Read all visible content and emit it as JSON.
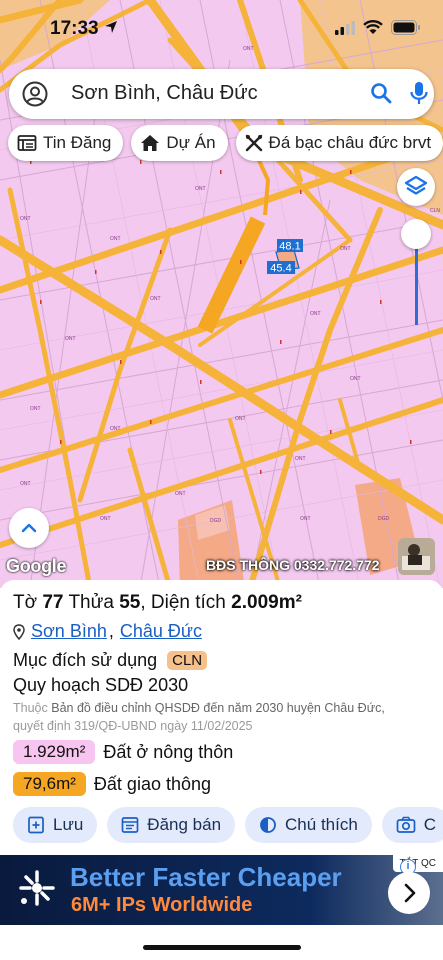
{
  "status_bar": {
    "time": "17:33"
  },
  "search": {
    "query": "Sơn Bình, Châu Đức"
  },
  "chips": [
    {
      "label": "Tin Đăng",
      "icon": "newspaper-icon"
    },
    {
      "label": "Dự Án",
      "icon": "house-icon"
    },
    {
      "label": "Đá bạc châu đức brvt",
      "icon": "crossed-tools-icon"
    }
  ],
  "map": {
    "zone_label": "ONT",
    "edge_label": "CLN",
    "parcel_labels": {
      "upper": "48.1",
      "lower": "45.4"
    },
    "pink_zone_label": "DGD",
    "attribution": "Google",
    "watermark": "BĐS THÔNG 0332.772.772"
  },
  "panel": {
    "title_prefix": "Tờ",
    "sheet_no": "77",
    "title_parcel": "Thửa",
    "parcel_no": "55",
    "area_label": ", Diện tích",
    "area_value": "2.009m²",
    "location": {
      "commune": "Sơn Bình",
      "separator": ",",
      "district": "Châu Đức"
    },
    "purpose_label": "Mục đích sử dụng",
    "purpose_code": "CLN",
    "plan_title": "Quy hoạch SDĐ 2030",
    "plan_note_prefix": "Thuộc",
    "plan_note": "Bản đồ điều chỉnh QHSDĐ đến năm 2030 huyện Châu Đức,",
    "plan_note_line2": "quyết định 319/QĐ-UBND ngày 11/02/2025",
    "legend": [
      {
        "area": "1.929m²",
        "label": "Đất ở nông thôn",
        "color": "#f8c4f0"
      },
      {
        "area": "79,6m²",
        "label": "Đất giao thông",
        "color": "#f5a623"
      }
    ],
    "actions": [
      {
        "label": "Lưu",
        "icon": "bookmark-plus-icon"
      },
      {
        "label": "Đăng bán",
        "icon": "listing-icon"
      },
      {
        "label": "Chú thích",
        "icon": "half-circle-icon"
      },
      {
        "label": "C",
        "icon": "camera-icon"
      }
    ]
  },
  "ad": {
    "badge": "TẮT QC",
    "headline": "Better Faster Cheaper",
    "subline": "6M+ IPs Worldwide",
    "info": "i"
  },
  "colors": {
    "accent": "#1a73e8",
    "road": "#f5b33a",
    "residential": "#f3c9ef",
    "cln": "#f4a987"
  }
}
